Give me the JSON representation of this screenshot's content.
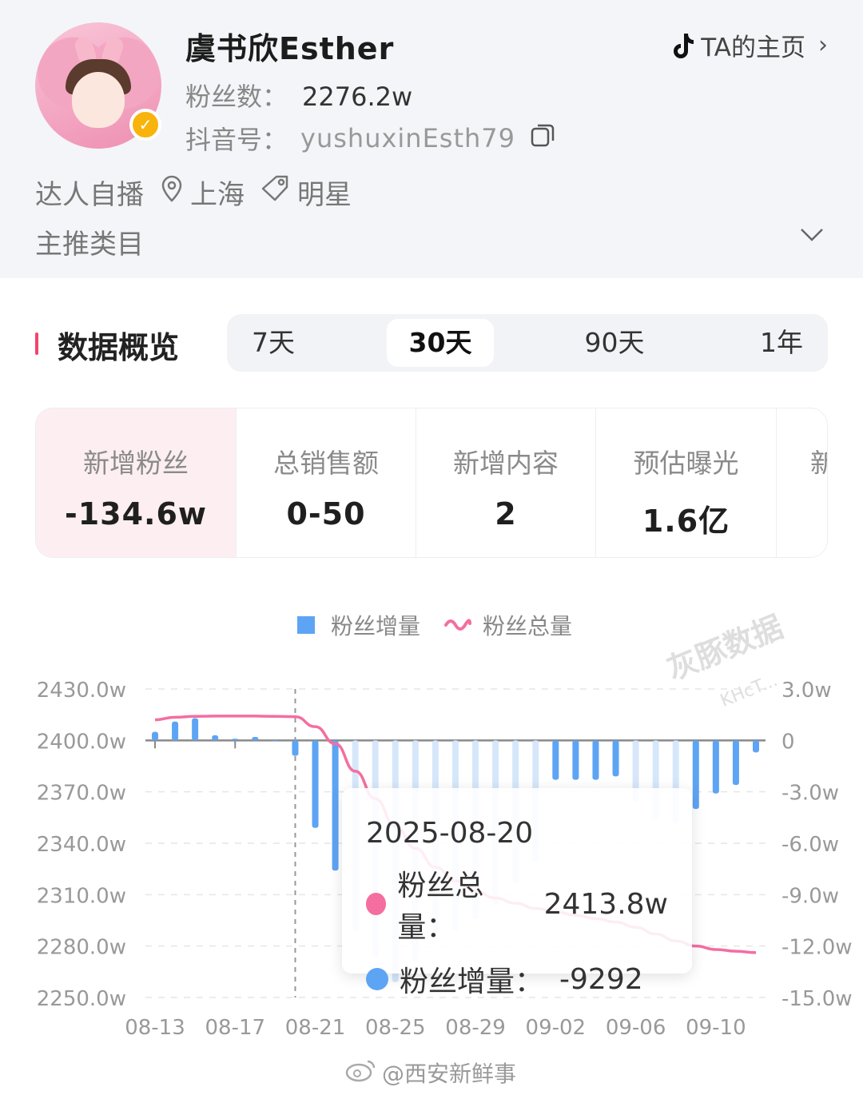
{
  "profile": {
    "name": "虞书欣Esther",
    "home_link": "TA的主页",
    "fans_label": "粉丝数：",
    "fans_value": "2276.2w",
    "id_label": "抖音号：",
    "id_value": "yushuxinEsth79",
    "tags": [
      "达人自播",
      "上海",
      "明星"
    ],
    "category_label": "主推类目"
  },
  "overview": {
    "title": "数据概览",
    "tabs": [
      "7天",
      "30天",
      "90天",
      "1年"
    ],
    "active_tab": "30天",
    "metrics": [
      {
        "label": "新增粉丝",
        "value": "-134.6w"
      },
      {
        "label": "总销售额",
        "value": "0-50"
      },
      {
        "label": "新增内容",
        "value": "2"
      },
      {
        "label": "预估曝光",
        "value": "1.6亿"
      },
      {
        "label": "新",
        "value": ""
      }
    ]
  },
  "legend": {
    "bar_series": "粉丝增量",
    "line_series": "粉丝总量"
  },
  "tooltip": {
    "date": "2025-08-20",
    "total_label": "粉丝总量：",
    "total_value": "2413.8w",
    "increment_label": "粉丝增量：",
    "increment_value": "-9292"
  },
  "watermark": "灰豚数据",
  "watermark_sub": "KHcT...",
  "credit": "@西安新鲜事",
  "colors": {
    "bar": "#5ea4f4",
    "bar_faded": "#d6e7fb",
    "line": "#f46ea0",
    "accent": "#f2456c",
    "tooltip_total_dot": "#f46ea0",
    "tooltip_increment_dot": "#5ea4f4"
  },
  "icons": [
    "tiktok-icon",
    "chevron-right-icon",
    "copy-icon",
    "location-pin-icon",
    "tag-icon",
    "chevron-down-icon",
    "verified-check-icon",
    "wave-legend-icon"
  ],
  "chart_data": {
    "type": "bar+line",
    "x_tick_labels": [
      "08-13",
      "08-17",
      "08-21",
      "08-25",
      "08-29",
      "09-02",
      "09-06",
      "09-10"
    ],
    "left_axis": {
      "labels": [
        "2430.0w",
        "2400.0w",
        "2370.0w",
        "2340.0w",
        "2310.0w",
        "2280.0w",
        "2250.0w"
      ],
      "range": [
        2250,
        2430
      ]
    },
    "right_axis": {
      "labels": [
        "3.0w",
        "0",
        "-3.0w",
        "-6.0w",
        "-9.0w",
        "-12.0w",
        "-15.0w"
      ],
      "range": [
        -15,
        3
      ]
    },
    "highlight_date": "2025-08-20",
    "series": [
      {
        "name": "粉丝增量",
        "axis": "right",
        "kind": "bar",
        "x": [
          "08-13",
          "08-14",
          "08-15",
          "08-16",
          "08-17",
          "08-18",
          "08-19",
          "08-20",
          "08-21",
          "08-22",
          "08-23",
          "08-24",
          "08-25",
          "08-26",
          "08-27",
          "08-28",
          "08-29",
          "08-30",
          "08-31",
          "09-01",
          "09-02",
          "09-03",
          "09-04",
          "09-05",
          "09-06",
          "09-07",
          "09-08",
          "09-09",
          "09-10",
          "09-11",
          "09-12"
        ],
        "values": [
          0.5,
          1.1,
          1.3,
          0.3,
          0.1,
          0.2,
          0.0,
          -0.9,
          -5.1,
          -7.6,
          -11.1,
          -12.6,
          -14.1,
          -12.9,
          -11.3,
          -11.1,
          -10.4,
          -9.6,
          -8.3,
          -7.1,
          -2.3,
          -2.3,
          -2.3,
          -2.1,
          -3.6,
          -4.6,
          -4.8,
          -4.0,
          -3.1,
          -2.6,
          -0.7
        ]
      },
      {
        "name": "粉丝总量",
        "axis": "left",
        "kind": "line",
        "x": [
          "08-13",
          "08-14",
          "08-15",
          "08-16",
          "08-17",
          "08-18",
          "08-19",
          "08-20",
          "08-21",
          "08-22",
          "08-23",
          "08-24",
          "08-25",
          "08-26",
          "08-27",
          "08-28",
          "08-29",
          "08-30",
          "08-31",
          "09-01",
          "09-02",
          "09-03",
          "09-04",
          "09-05",
          "09-06",
          "09-07",
          "09-08",
          "09-09",
          "09-10",
          "09-11",
          "09-12"
        ],
        "values": [
          2412.0,
          2413.5,
          2414.0,
          2414.2,
          2414.2,
          2414.2,
          2414.0,
          2413.8,
          2408.0,
          2398.0,
          2382.0,
          2366.0,
          2350.0,
          2337.0,
          2326.0,
          2318.0,
          2312.0,
          2308.0,
          2305.0,
          2302.0,
          2300.0,
          2298.0,
          2296.0,
          2294.0,
          2291.0,
          2287.0,
          2283.0,
          2280.0,
          2278.0,
          2277.0,
          2276.2
        ]
      }
    ],
    "grid": true,
    "legend_position": "top-center"
  }
}
